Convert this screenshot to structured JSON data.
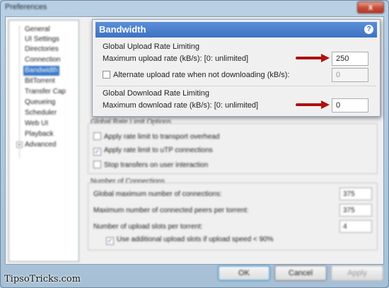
{
  "window": {
    "title": "Preferences",
    "close_label": "x"
  },
  "sidebar": {
    "items": [
      {
        "label": "General"
      },
      {
        "label": "UI Settings"
      },
      {
        "label": "Directories"
      },
      {
        "label": "Connection"
      },
      {
        "label": "Bandwidth",
        "selected": true
      },
      {
        "label": "BitTorrent"
      },
      {
        "label": "Transfer Cap"
      },
      {
        "label": "Queueing"
      },
      {
        "label": "Scheduler"
      },
      {
        "label": "Web UI"
      },
      {
        "label": "Playback"
      },
      {
        "label": "Advanced",
        "expander": "+"
      }
    ]
  },
  "panel": {
    "header": "Bandwidth",
    "help_icon": "?",
    "upload": {
      "group_title": "Global Upload Rate Limiting",
      "max_label": "Maximum upload rate (kB/s): [0: unlimited]",
      "max_value": "250",
      "alt_label": "Alternate upload rate when not downloading (kB/s):",
      "alt_value": "0",
      "alt_checked": false
    },
    "download": {
      "group_title": "Global Download Rate Limiting",
      "max_label": "Maximum download rate (kB/s): [0: unlimited]",
      "max_value": "0"
    },
    "options": {
      "group_title": "Global Rate Limit Options",
      "items": [
        {
          "label": "Apply rate limit to transport overhead",
          "checked": false
        },
        {
          "label": "Apply rate limit to uTP connections",
          "checked": true
        },
        {
          "label": "Stop transfers on user interaction",
          "checked": false
        }
      ]
    },
    "connections": {
      "group_title": "Number of Connections",
      "rows": [
        {
          "label": "Global maximum number of connections:",
          "value": "375"
        },
        {
          "label": "Maximum number of connected peers per torrent:",
          "value": "375"
        },
        {
          "label": "Number of upload slots per torrent:",
          "value": "4"
        }
      ],
      "extra_label": "Use additional upload slots if upload speed < 90%",
      "extra_checked": true
    }
  },
  "buttons": {
    "ok": "OK",
    "cancel": "Cancel",
    "apply": "Apply"
  },
  "watermark": "TipsoTricks.com",
  "colors": {
    "accent": "#3d72c3",
    "arrow": "#b01010"
  }
}
